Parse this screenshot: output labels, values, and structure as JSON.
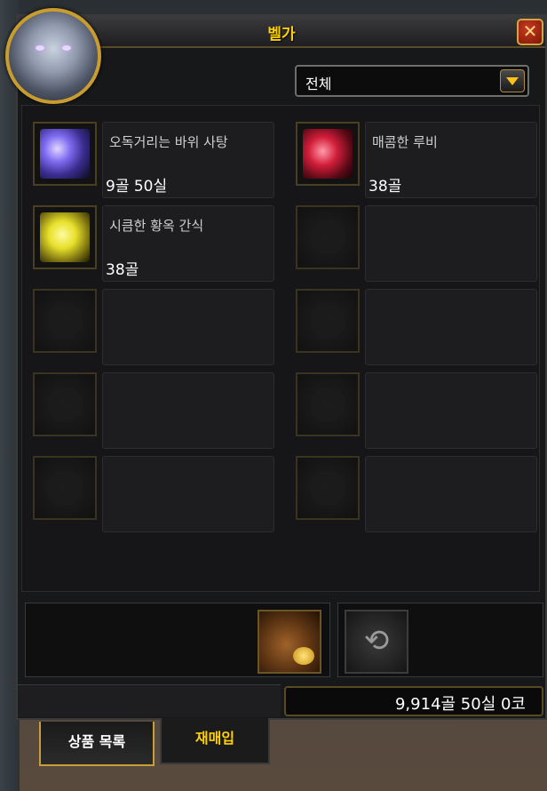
{
  "window": {
    "title": "벨가",
    "close_label": "✕"
  },
  "filter": {
    "selected": "전체"
  },
  "items": [
    {
      "name": "오독거리는 바위 사탕",
      "price": "9골  50실",
      "icon": "crystal-candy-icon"
    },
    {
      "name": "매콤한 루비",
      "price": "38골",
      "icon": "ruby-icon"
    },
    {
      "name": "시큼한 황옥 간식",
      "price": "38골",
      "icon": "topaz-icon"
    }
  ],
  "footer": {
    "money": "9,914골  50실  0코"
  },
  "tabs": [
    {
      "label": "상품 목록",
      "active": true
    },
    {
      "label": "재매입",
      "active": false
    }
  ],
  "colors": {
    "title": "#ffd100",
    "border_gold": "#c79f36"
  }
}
